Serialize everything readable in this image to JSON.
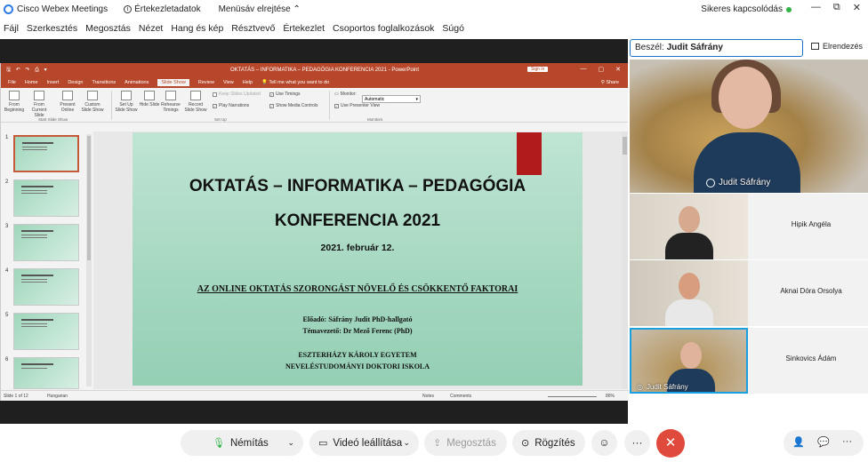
{
  "titlebar": {
    "app_name": "Cisco Webex Meetings",
    "notifications_label": "Értekezletadatok",
    "menubar_toggle": "Menüsáv elrejtése",
    "connection_status": "Sikeres kapcsolódás",
    "minimize": "—",
    "restore": "⧉",
    "close": "✕"
  },
  "menubar": {
    "items": [
      "Fájl",
      "Szerkesztés",
      "Megosztás",
      "Nézet",
      "Hang és kép",
      "Résztvevő",
      "Értekezlet",
      "Csoportos foglalkozások",
      "Súgó"
    ]
  },
  "ppt": {
    "quick_access": "🖫 ↶ ↷ ⎙ ▾",
    "doc_title": "OKTATÁS – INFORMATIKA – PEDAGÓGIA KONFERENCIA 2021  -  PowerPoint",
    "sign_in": "Sign in",
    "win_min": "—",
    "win_max": "▢",
    "win_close": "✕",
    "tabs": [
      "File",
      "Home",
      "Insert",
      "Design",
      "Transitions",
      "Animations",
      "Slide Show",
      "Review",
      "View",
      "Help"
    ],
    "tell_me": "Tell me what you want to do",
    "share": "Share",
    "ribbon": {
      "from_beginning": "From Beginning",
      "from_current": "From Current Slide",
      "present_online": "Present Online",
      "custom_show": "Custom Slide Show",
      "group_start": "Start Slide Show",
      "set_up": "Set Up Slide Show",
      "hide_slide": "Hide Slide",
      "rehearse": "Rehearse Timings",
      "record": "Record Slide Show",
      "keep_updated": "Keep Slides Updated",
      "play_narrations": "Play Narrations",
      "use_timings": "Use Timings",
      "show_media": "Show Media Controls",
      "group_setup": "Set Up",
      "monitor_label": "Monitor:",
      "monitor_value": "Automatic",
      "presenter_view": "Use Presenter View",
      "group_monitors": "Monitors"
    },
    "thumb_numbers": [
      "1",
      "2",
      "3",
      "4",
      "5",
      "6"
    ],
    "status": {
      "slide_of": "Slide 1 of 12",
      "language": "Hungarian",
      "notes": "Notes",
      "comments": "Comments",
      "zoom": "86%"
    }
  },
  "slide": {
    "title_line1": "OKTATÁS – INFORMATIKA – PEDAGÓGIA",
    "title_line2": "KONFERENCIA 2021",
    "date": "2021. február 12.",
    "topic": "AZ ONLINE OKTATÁS SZORONGÁST NÖVELŐ ÉS CSÖKKENTŐ FAKTORAI",
    "presenter": "Előadó: Sáfrány Judit PhD-hallgató",
    "supervisor": "Témavezető: Dr Mező Ferenc (PhD)",
    "university": "ESZTERHÁZY KÁROLY EGYETEM",
    "school": "NEVELÉSTUDOMÁNYI DOKTORI ISKOLA"
  },
  "panel": {
    "speaker_label": "Beszél:",
    "speaker_name": "Judit Sáfrány",
    "layout_button": "Elrendezés",
    "main_video_name": "Judit Sáfrány",
    "participants": [
      {
        "name": "Hipik Angéla"
      },
      {
        "name": "Aknai Dóra Orsolya"
      },
      {
        "name": "Sinkovics Ádám",
        "video_label": "Judit Sáfrány"
      }
    ]
  },
  "controls": {
    "mute": "Némítás",
    "video": "Videó leállítása",
    "share": "Megosztás",
    "record": "Rögzítés",
    "emoji": "☺",
    "more": "···",
    "end": "✕",
    "participants_icon": "👤",
    "chat_icon": "💬",
    "more_right": "···"
  },
  "colors": {
    "ppt_accent": "#b7472a",
    "end_button": "#e04a3c",
    "active_border": "#18a0e0",
    "connected_dot": "#2fb344"
  }
}
